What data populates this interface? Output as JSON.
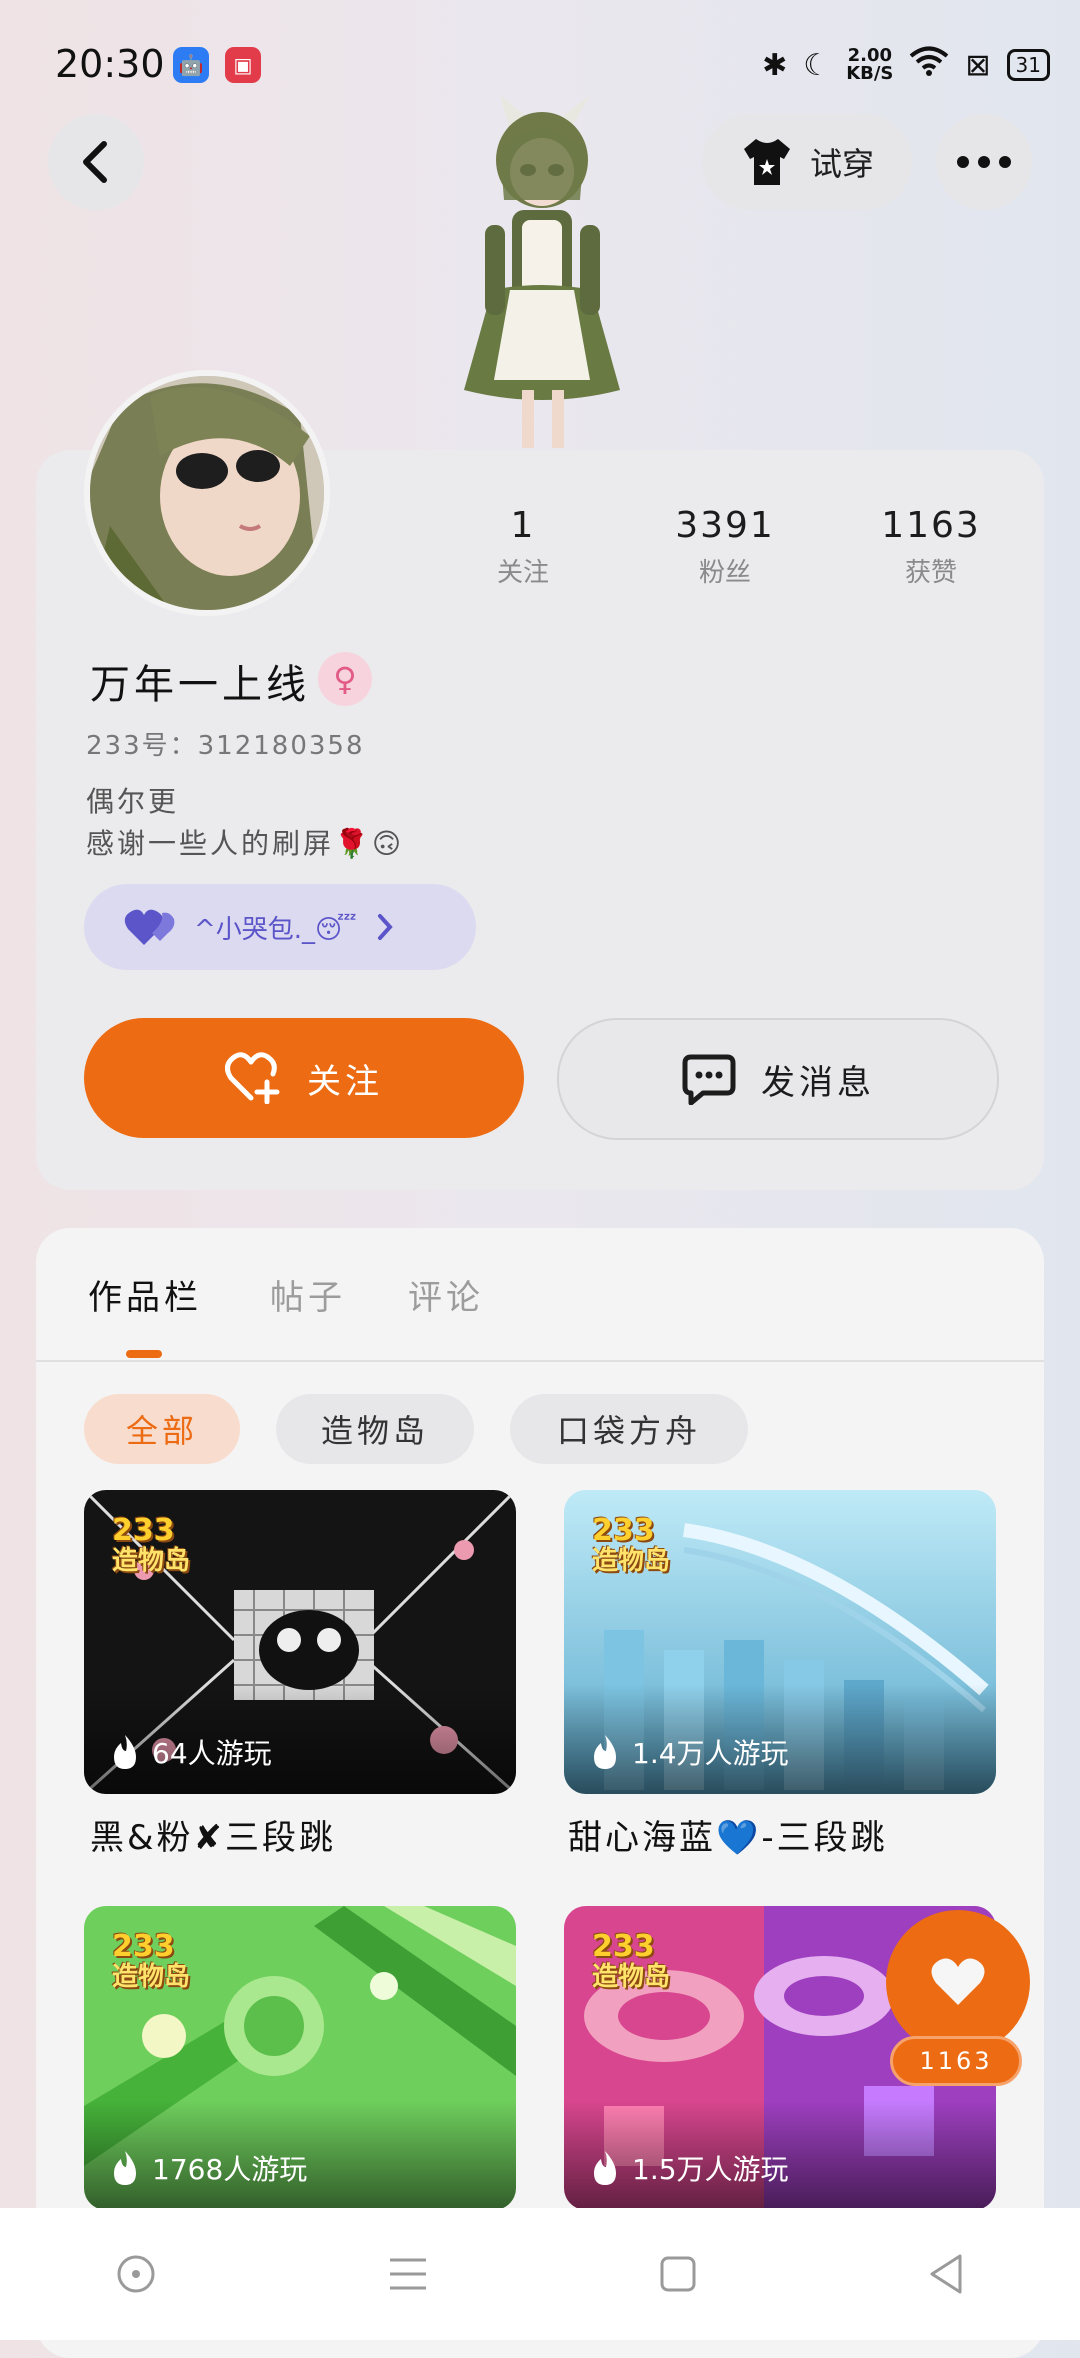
{
  "status_bar": {
    "time": "20:30",
    "net_speed_value": "2.00",
    "net_speed_unit": "KB/S",
    "battery": "31",
    "icons": [
      "android-icon",
      "screen-record-icon",
      "bluetooth-icon",
      "moon-icon",
      "wifi-icon",
      "sim-icon",
      "battery-icon"
    ]
  },
  "header": {
    "try_on_label": "试穿"
  },
  "profile": {
    "stats": [
      {
        "value": "1",
        "label": "关注"
      },
      {
        "value": "3391",
        "label": "粉丝"
      },
      {
        "value": "1163",
        "label": "获赞"
      }
    ],
    "username": "万年一上线",
    "gender_symbol": "♀",
    "uid": "233号：312180358",
    "bio_line1": "偶尔更",
    "bio_line2": "感谢一些人的刷屏🌹🙃",
    "fan_badge_text": "^小哭包._😴",
    "follow_label": "关注",
    "message_label": "发消息"
  },
  "tabs": [
    "作品栏",
    "帖子",
    "评论"
  ],
  "filters": [
    "全部",
    "造物岛",
    "口袋方舟"
  ],
  "games": [
    {
      "title": "黑&粉✘三段跳",
      "plays": "64人游玩"
    },
    {
      "title": "甜心海蓝💙-三段跳",
      "plays": "1.4万人游玩"
    },
    {
      "title": "",
      "plays": "1768人游玩"
    },
    {
      "title": "",
      "plays": "1.5万人游玩"
    }
  ],
  "logo_text": {
    "top": "233",
    "bottom": "造物岛"
  },
  "like_fab_count": "1163",
  "colors": {
    "accent": "#ec6b13",
    "badge": "#5b55c9"
  }
}
